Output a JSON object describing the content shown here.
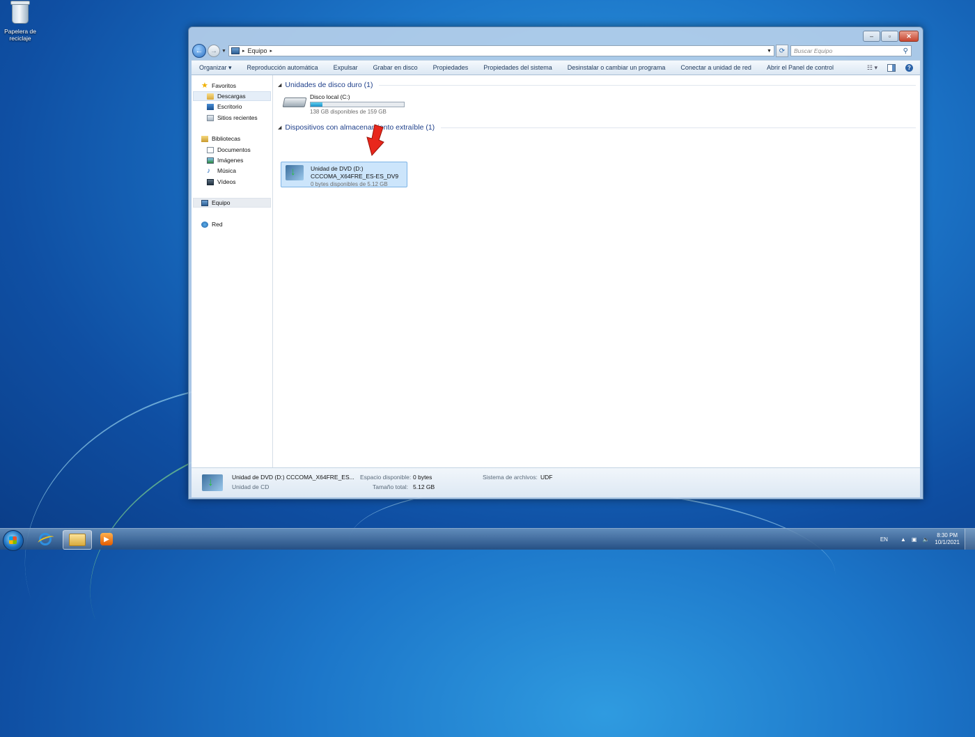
{
  "desktop": {
    "recycle_bin_label": "Papelera de reciclaje"
  },
  "window": {
    "address": {
      "location": "Equipo"
    },
    "search": {
      "placeholder": "Buscar Equipo"
    },
    "toolbar": {
      "organize": "Organizar",
      "autoplay": "Reproducción automática",
      "eject": "Expulsar",
      "burn": "Grabar en disco",
      "properties": "Propiedades",
      "system_properties": "Propiedades del sistema",
      "uninstall": "Desinstalar o cambiar un programa",
      "map_drive": "Conectar a unidad de red",
      "control_panel": "Abrir el Panel de control"
    },
    "nav_pane": {
      "favorites": "Favoritos",
      "downloads": "Descargas",
      "desktop": "Escritorio",
      "recent": "Sitios recientes",
      "libraries": "Bibliotecas",
      "documents": "Documentos",
      "images": "Imágenes",
      "music": "Música",
      "videos": "Vídeos",
      "computer": "Equipo",
      "network": "Red"
    },
    "content": {
      "hdd_group": "Unidades de disco duro (1)",
      "local_disk": {
        "name": "Disco local (C:)",
        "free": "138 GB disponibles de 159 GB",
        "used_fraction": 0.13
      },
      "removable_group": "Dispositivos con almacenamiento extraíble (1)",
      "dvd": {
        "name": "Unidad de DVD (D:)",
        "label": "CCCOMA_X64FRE_ES-ES_DV9",
        "free": "0 bytes disponibles de 5.12 GB"
      }
    },
    "details": {
      "title": "Unidad de DVD (D:) CCCOMA_X64FRE_ES...",
      "type": "Unidad de CD",
      "free_label": "Espacio disponible:",
      "free_value": "0 bytes",
      "total_label": "Tamaño total:",
      "total_value": "5.12 GB",
      "fs_label": "Sistema de archivos:",
      "fs_value": "UDF"
    }
  },
  "taskbar": {
    "language": "EN",
    "time": "8:30 PM",
    "date": "10/1/2021"
  },
  "colors": {
    "desktop": "#1c76c9",
    "group_header": "#1e3f8a",
    "selection": "#cce5fb",
    "arrow": "#e8271c"
  }
}
